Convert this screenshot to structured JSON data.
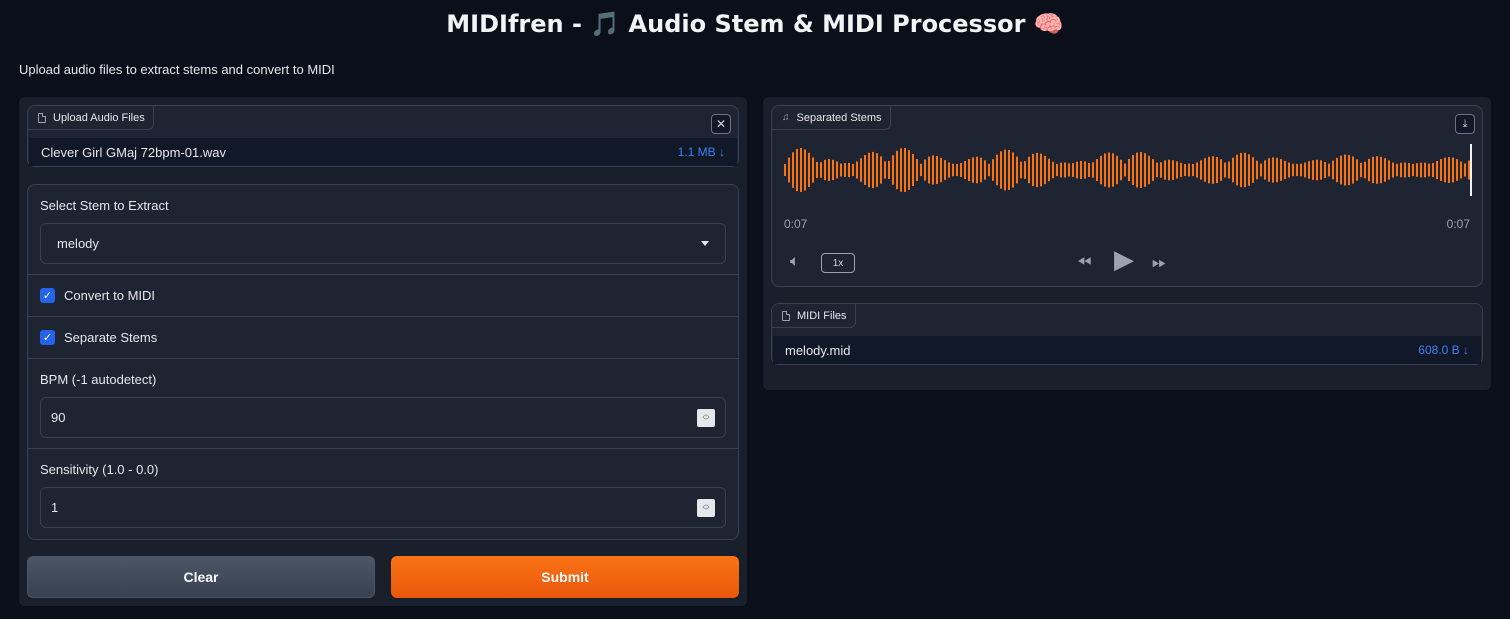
{
  "header": {
    "title_text": "MIDIfren - ",
    "note_emoji": "🎵",
    "title_rest": " Audio Stem & MIDI Processor ",
    "brain_emoji": "🧠",
    "subtitle": "Upload audio files to extract stems and convert to MIDI"
  },
  "upload": {
    "label": "Upload Audio Files",
    "file_name": "Clever Girl GMaj 72bpm-01.wav",
    "file_size": "1.1 MB ↓",
    "close_glyph": "✕"
  },
  "form": {
    "stem_label": "Select Stem to Extract",
    "stem_value": "melody",
    "convert_midi_label": "Convert to MIDI",
    "convert_midi_checked": true,
    "separate_stems_label": "Separate Stems",
    "separate_stems_checked": true,
    "bpm_label": "BPM (-1 autodetect)",
    "bpm_value": "90",
    "sensitivity_label": "Sensitivity (1.0 - 0.0)",
    "sensitivity_value": "1"
  },
  "actions": {
    "clear_label": "Clear",
    "submit_label": "Submit"
  },
  "audio": {
    "label": "Separated Stems",
    "current_time": "0:07",
    "duration": "0:07",
    "speed": "1x",
    "progress": 1.0,
    "wave_color": "#f97316"
  },
  "midi": {
    "label": "MIDI Files",
    "file_name": "melody.mid",
    "file_size": "608.0 B ↓"
  },
  "colors": {
    "accent": "#f97316",
    "link": "#3b82f6",
    "checkbox": "#2563eb"
  }
}
